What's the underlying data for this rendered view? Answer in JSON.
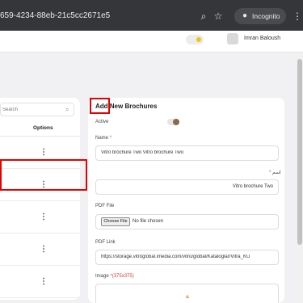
{
  "browser": {
    "url_fragment": "659-4234-88eb-21c5cc2671e5",
    "incognito_label": "Incognito",
    "icons": [
      "search-icon",
      "star-icon",
      "incognito-icon",
      "more-vert-icon"
    ]
  },
  "header": {
    "user_name": "Imran Baloush",
    "theme_toggle_accent": "#f1c40f"
  },
  "list": {
    "search_placeholder": "Search",
    "options_header": "Options",
    "row_option_glyph": "⋮"
  },
  "form": {
    "title": "Add New Brochures",
    "active_label": "Active",
    "name_label": "Name",
    "name_value": "Vitro brochure Two Vitro brochure Two",
    "name_ar_label": "اسم",
    "name_ar_value": "Vitro brochure Two",
    "pdf_file_label": "PDF File",
    "choose_file_label": "Choose File",
    "no_file_text": "No file chosen",
    "pdf_link_label": "PDF Link",
    "pdf_link_value": "https://storage.vitroglobal.imedia.com/vitro/global/Kataloglar/Vitra_KU",
    "image_label": "Image",
    "image_hint": "*(375x375)",
    "required_marker": "*"
  },
  "colors": {
    "highlight": "#e60000",
    "required": "#e53935",
    "toggle_knob": "#8a6b45"
  }
}
